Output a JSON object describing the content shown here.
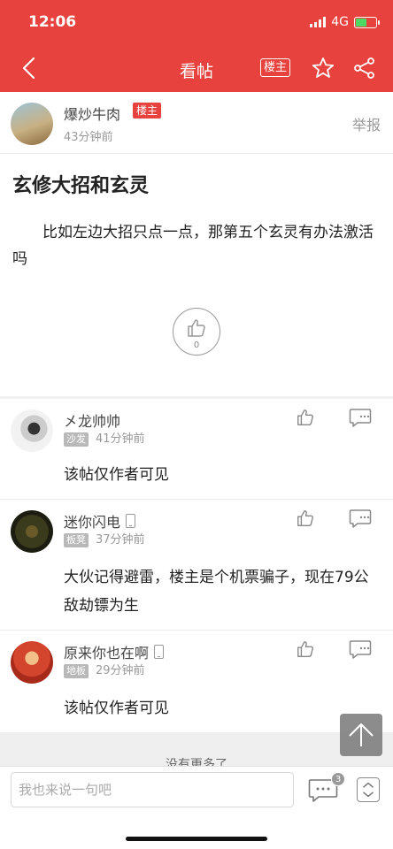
{
  "status_bar": {
    "time": "12:06",
    "network": "4G"
  },
  "nav": {
    "title": "看帖",
    "louzhu_label": "楼主"
  },
  "author": {
    "name": "爆炒牛肉",
    "badge": "楼主",
    "time": "43分钟前",
    "report_label": "举报"
  },
  "post": {
    "title": "玄修大招和玄灵",
    "body": "比如左边大招只点一点，那第五个玄灵有办法激活吗",
    "like_count": "0"
  },
  "replies": [
    {
      "name": "㐅龙帅帅",
      "floor": "沙发",
      "time": "41分钟前",
      "text": "该帖仅作者可见",
      "mobile": false
    },
    {
      "name": "迷你闪电",
      "floor": "板凳",
      "time": "37分钟前",
      "text": "大伙记得避雷，楼主是个机票骗子，现在79公敌劫镖为生",
      "mobile": true
    },
    {
      "name": "原来你也在啊",
      "floor": "地板",
      "time": "29分钟前",
      "text": "该帖仅作者可见",
      "mobile": true
    }
  ],
  "footer": {
    "no_more": "没有更多了",
    "input_placeholder": "我也来说一句吧",
    "comment_count": "3"
  },
  "colors": {
    "accent": "#e8423f",
    "battery": "#4cd964"
  }
}
